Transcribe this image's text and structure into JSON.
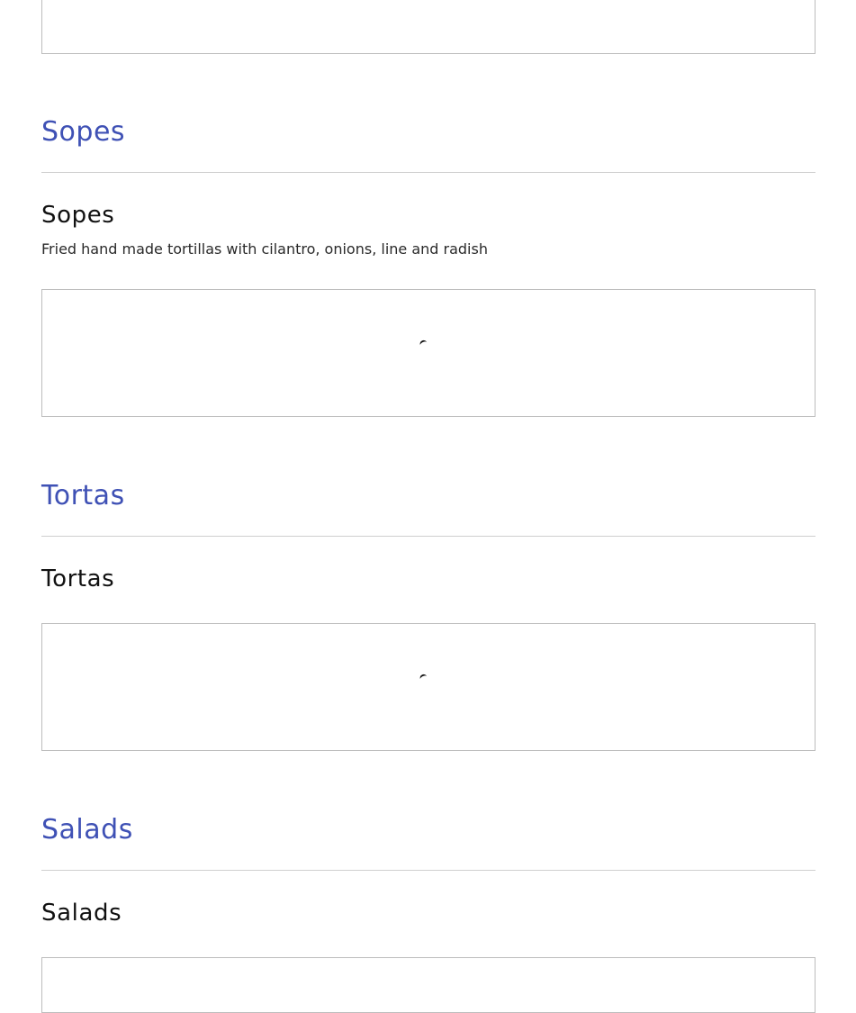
{
  "theme": {
    "accent": "#3f51b5"
  },
  "sections": [
    {
      "heading": "Sopes",
      "item_title": "Sopes",
      "item_description": "Fried hand made tortillas with cilantro, onions, line and radish",
      "loading": true
    },
    {
      "heading": "Tortas",
      "item_title": "Tortas",
      "item_description": "",
      "loading": true
    },
    {
      "heading": "Salads",
      "item_title": "Salads",
      "item_description": "",
      "loading": true
    }
  ],
  "icons": {
    "loading_spinner": "spinner-icon"
  }
}
